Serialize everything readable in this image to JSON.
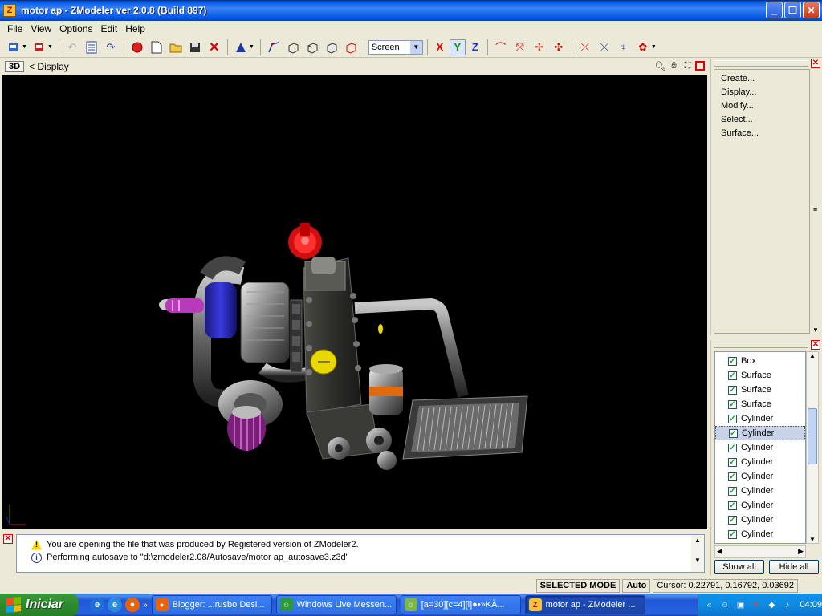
{
  "window": {
    "title": "motor ap - ZModeler ver 2.0.8 (Build 897)",
    "app_icon_letter": "Z"
  },
  "menu": [
    "File",
    "View",
    "Options",
    "Edit",
    "Help"
  ],
  "toolbar": {
    "space_select": "Screen",
    "axes": [
      "X",
      "Y",
      "Z"
    ]
  },
  "viewport": {
    "mode_label": "3D",
    "nav_label": "< Display",
    "background": "#000000"
  },
  "command_panel": {
    "items": [
      "Create...",
      "Display...",
      "Modify...",
      "Select...",
      "Surface..."
    ]
  },
  "object_panel": {
    "items": [
      {
        "label": "Box",
        "checked": true,
        "selected": false
      },
      {
        "label": "Surface",
        "checked": true,
        "selected": false
      },
      {
        "label": "Surface",
        "checked": true,
        "selected": false
      },
      {
        "label": "Surface",
        "checked": true,
        "selected": false
      },
      {
        "label": "Cylinder",
        "checked": true,
        "selected": false
      },
      {
        "label": "Cylinder",
        "checked": true,
        "selected": true
      },
      {
        "label": "Cylinder",
        "checked": true,
        "selected": false
      },
      {
        "label": "Cylinder",
        "checked": true,
        "selected": false
      },
      {
        "label": "Cylinder",
        "checked": true,
        "selected": false
      },
      {
        "label": "Cylinder",
        "checked": true,
        "selected": false
      },
      {
        "label": "Cylinder",
        "checked": true,
        "selected": false
      },
      {
        "label": "Cylinder",
        "checked": true,
        "selected": false
      },
      {
        "label": "Cylinder",
        "checked": true,
        "selected": false
      }
    ],
    "show_all_label": "Show all",
    "hide_all_label": "Hide all"
  },
  "log": {
    "messages": [
      {
        "type": "warning",
        "text": "You are opening the file that was produced by Registered version of ZModeler2."
      },
      {
        "type": "info",
        "text": "Performing autosave to \"d:\\zmodeler2.08/Autosave/motor ap_autosave3.z3d\""
      }
    ]
  },
  "status": {
    "mode": "SELECTED MODE",
    "auto": "Auto",
    "cursor": "Cursor: 0.22791, 0.16792, 0.03692"
  },
  "taskbar": {
    "start_label": "Iniciar",
    "tasks": [
      {
        "label": "Blogger: ..:rusbo Desi...",
        "active": false,
        "icon_color": "#e8630a"
      },
      {
        "label": "Windows Live Messen...",
        "active": false,
        "icon_color": "#2a9a3a"
      },
      {
        "label": "[a=30][c=4][i]●•»KÄ...",
        "active": false,
        "icon_color": "#7ab648"
      },
      {
        "label": "motor ap - ZModeler ...",
        "active": true,
        "icon_color": "#f7c23a"
      }
    ],
    "time": "04:09"
  }
}
